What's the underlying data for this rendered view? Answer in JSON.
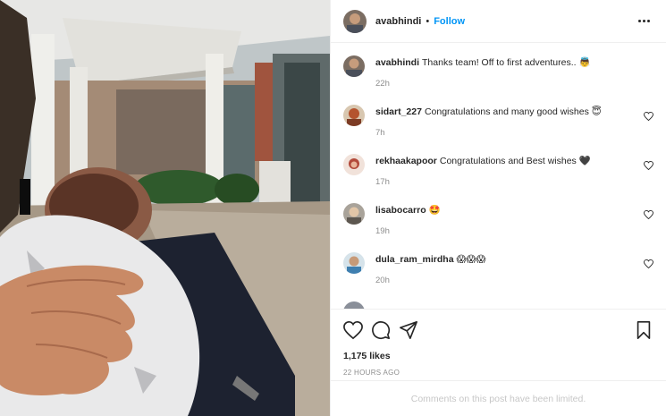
{
  "post": {
    "username": "avabhindi",
    "separator": "•",
    "follow_label": "Follow",
    "likes": "1,175 likes",
    "posted": "22 HOURS AGO",
    "comments_limited": "Comments on this post have been limited."
  },
  "comments": [
    {
      "username": "avabhindi",
      "text": "Thanks team! Off to first adventures..",
      "emoji": "👼",
      "time": "22h",
      "likeable": false
    },
    {
      "username": "sidart_227",
      "text": "Congratulations and many good wishes",
      "emoji": "😇",
      "time": "7h",
      "likeable": true
    },
    {
      "username": "rekhaakapoor",
      "text": "Congratulations and Best wishes",
      "emoji": "🖤",
      "time": "17h",
      "likeable": true
    },
    {
      "username": "lisabocarro",
      "text": "",
      "emoji": "🤩",
      "time": "19h",
      "likeable": true
    },
    {
      "username": "dula_ram_mirdha",
      "text": "",
      "emoji": "😱😱😱",
      "time": "20h",
      "likeable": true
    }
  ],
  "partial_comment": {
    "username": "",
    "text": ""
  },
  "colors": {
    "link_blue": "#0095f6",
    "muted": "#8e8e8e",
    "border": "#efefef"
  },
  "icons": [
    "heart-icon",
    "comment-icon",
    "share-icon",
    "bookmark-icon",
    "more-options-icon"
  ]
}
